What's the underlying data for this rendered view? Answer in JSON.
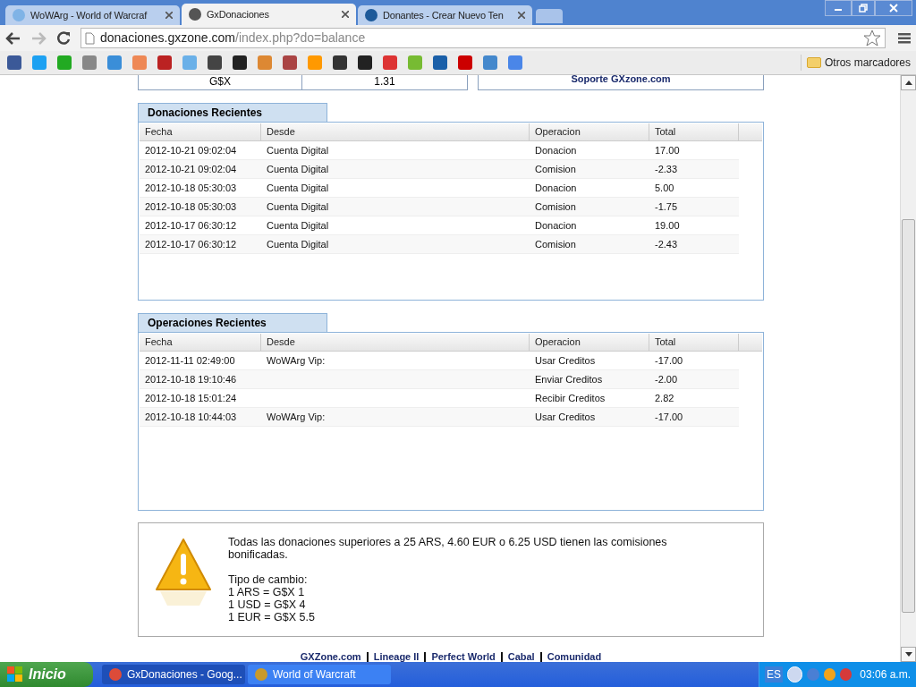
{
  "browser": {
    "tabs": [
      {
        "title": "WoWArg - World of Warcraf",
        "selected": false
      },
      {
        "title": "GxDonaciones",
        "selected": true
      },
      {
        "title": "Donantes - Crear Nuevo Ten",
        "selected": false
      }
    ],
    "url_host": "donaciones.gxzone.com",
    "url_path": "/index.php?do=balance",
    "other_bookmarks": "Otros marcadores"
  },
  "balance": {
    "currency": "G$X",
    "amount": "1.31",
    "support": "Soporte GXzone.com"
  },
  "sections": [
    {
      "title": "Donaciones Recientes",
      "columns": [
        "Fecha",
        "Desde",
        "Operacion",
        "Total"
      ],
      "rows": [
        [
          "2012-10-21 09:02:04",
          "Cuenta Digital",
          "Donacion",
          "17.00"
        ],
        [
          "2012-10-21 09:02:04",
          "Cuenta Digital",
          "Comision",
          "-2.33"
        ],
        [
          "2012-10-18 05:30:03",
          "Cuenta Digital",
          "Donacion",
          "5.00"
        ],
        [
          "2012-10-18 05:30:03",
          "Cuenta Digital",
          "Comision",
          "-1.75"
        ],
        [
          "2012-10-17 06:30:12",
          "Cuenta Digital",
          "Donacion",
          "19.00"
        ],
        [
          "2012-10-17 06:30:12",
          "Cuenta Digital",
          "Comision",
          "-2.43"
        ]
      ]
    },
    {
      "title": "Operaciones Recientes",
      "columns": [
        "Fecha",
        "Desde",
        "Operacion",
        "Total"
      ],
      "rows": [
        [
          "2012-11-11 02:49:00",
          "WoWArg Vip:",
          "Usar Creditos",
          "-17.00"
        ],
        [
          "2012-10-18 19:10:46",
          "",
          "Enviar Creditos",
          "-2.00"
        ],
        [
          "2012-10-18 15:01:24",
          "",
          "Recibir Creditos",
          "2.82"
        ],
        [
          "2012-10-18 10:44:03",
          "WoWArg Vip:",
          "Usar Creditos",
          "-17.00"
        ]
      ]
    }
  ],
  "notice": {
    "text": "Todas las donaciones superiores a 25 ARS, 4.60 EUR o 6.25 USD tienen las comisiones bonificadas.",
    "rates_title": "Tipo de cambio:",
    "rates": [
      "1 ARS = G$X 1",
      "1 USD = G$X 4",
      "1 EUR = G$X 5.5"
    ]
  },
  "footer_links": [
    "GXZone.com",
    "Lineage II",
    "Perfect World",
    "Cabal",
    "Comunidad"
  ],
  "taskbar": {
    "start": "Inicio",
    "windows": [
      {
        "title": "GxDonaciones - Goog...",
        "selected": true
      },
      {
        "title": "World of Warcraft",
        "selected": false
      }
    ],
    "language": "ES",
    "clock": "03:06 a.m."
  }
}
